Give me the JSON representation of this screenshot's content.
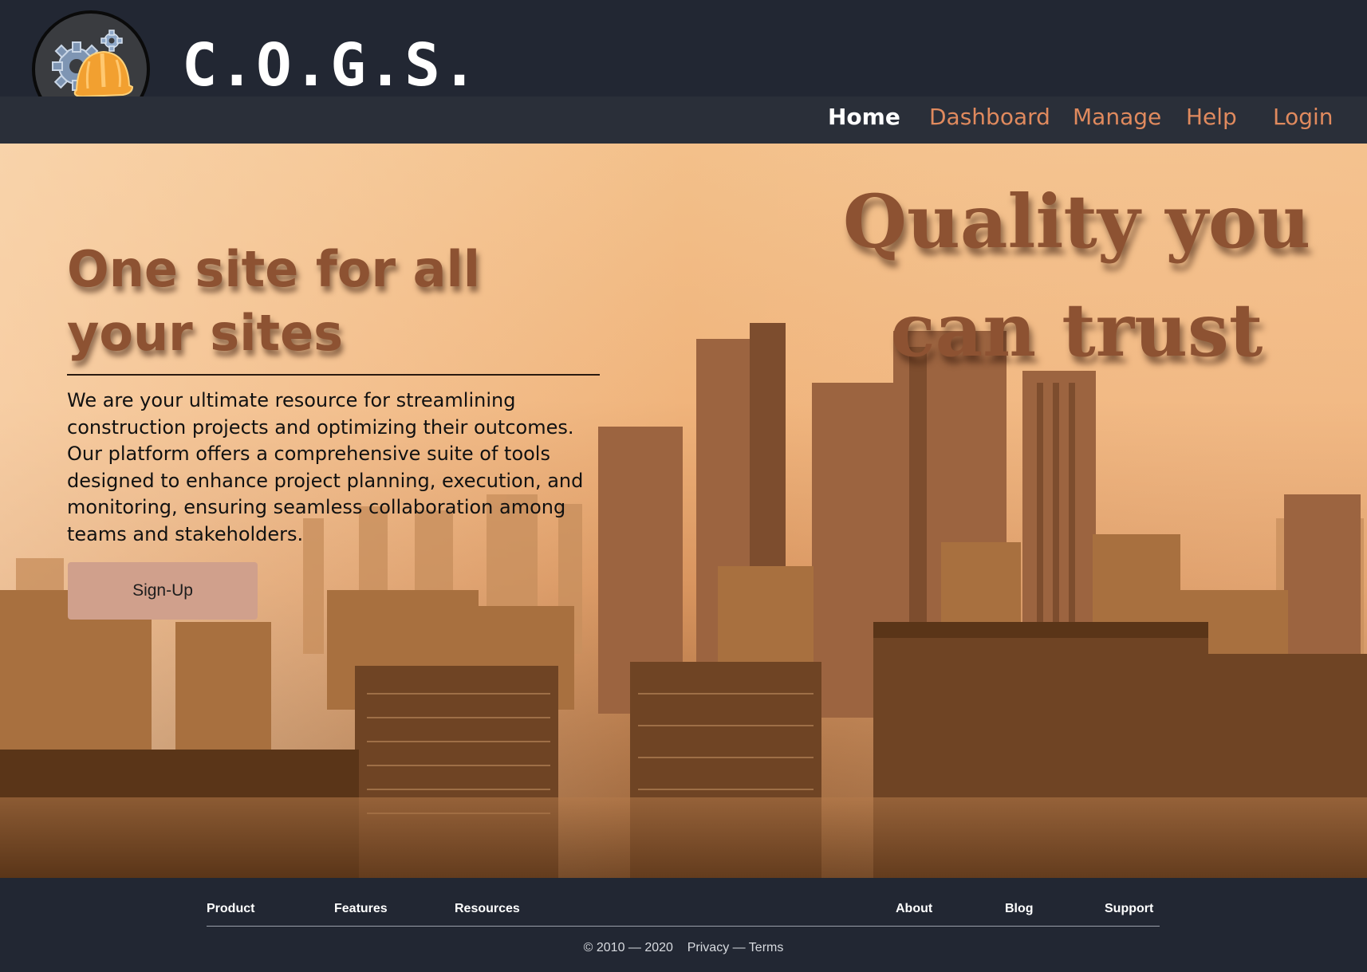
{
  "header": {
    "brand": "C.O.G.S.",
    "logo_icon": "gear-hardhat-icon",
    "nav": [
      {
        "label": "Home",
        "active": true
      },
      {
        "label": "Dashboard",
        "active": false
      },
      {
        "label": "Manage",
        "active": false
      },
      {
        "label": "Help",
        "active": false
      },
      {
        "label": "Login",
        "active": false
      }
    ]
  },
  "hero": {
    "title": "One site for all\nyour  sites",
    "description": "We are your ultimate resource for streamlining construction projects and optimizing their outcomes. Our platform offers a comprehensive suite of tools designed to enhance project planning, execution, and monitoring, ensuring seamless collaboration among teams and stakeholders.",
    "signup_label": "Sign-Up",
    "tagline": "Quality you\ncan trust",
    "background": "city-skyline-image"
  },
  "footer": {
    "left_links": [
      "Product",
      "Features",
      "Resources"
    ],
    "right_links": [
      "About",
      "Blog",
      "Support"
    ],
    "copyright": "© 2010 — 2020",
    "privacy": "Privacy",
    "separator": "—",
    "terms": "Terms"
  },
  "colors": {
    "header_bg": "#222733",
    "nav_bg": "#2a2f39",
    "accent": "#e08a5e",
    "hero_text": "#8d5232",
    "button_bg": "#d0a08c"
  }
}
